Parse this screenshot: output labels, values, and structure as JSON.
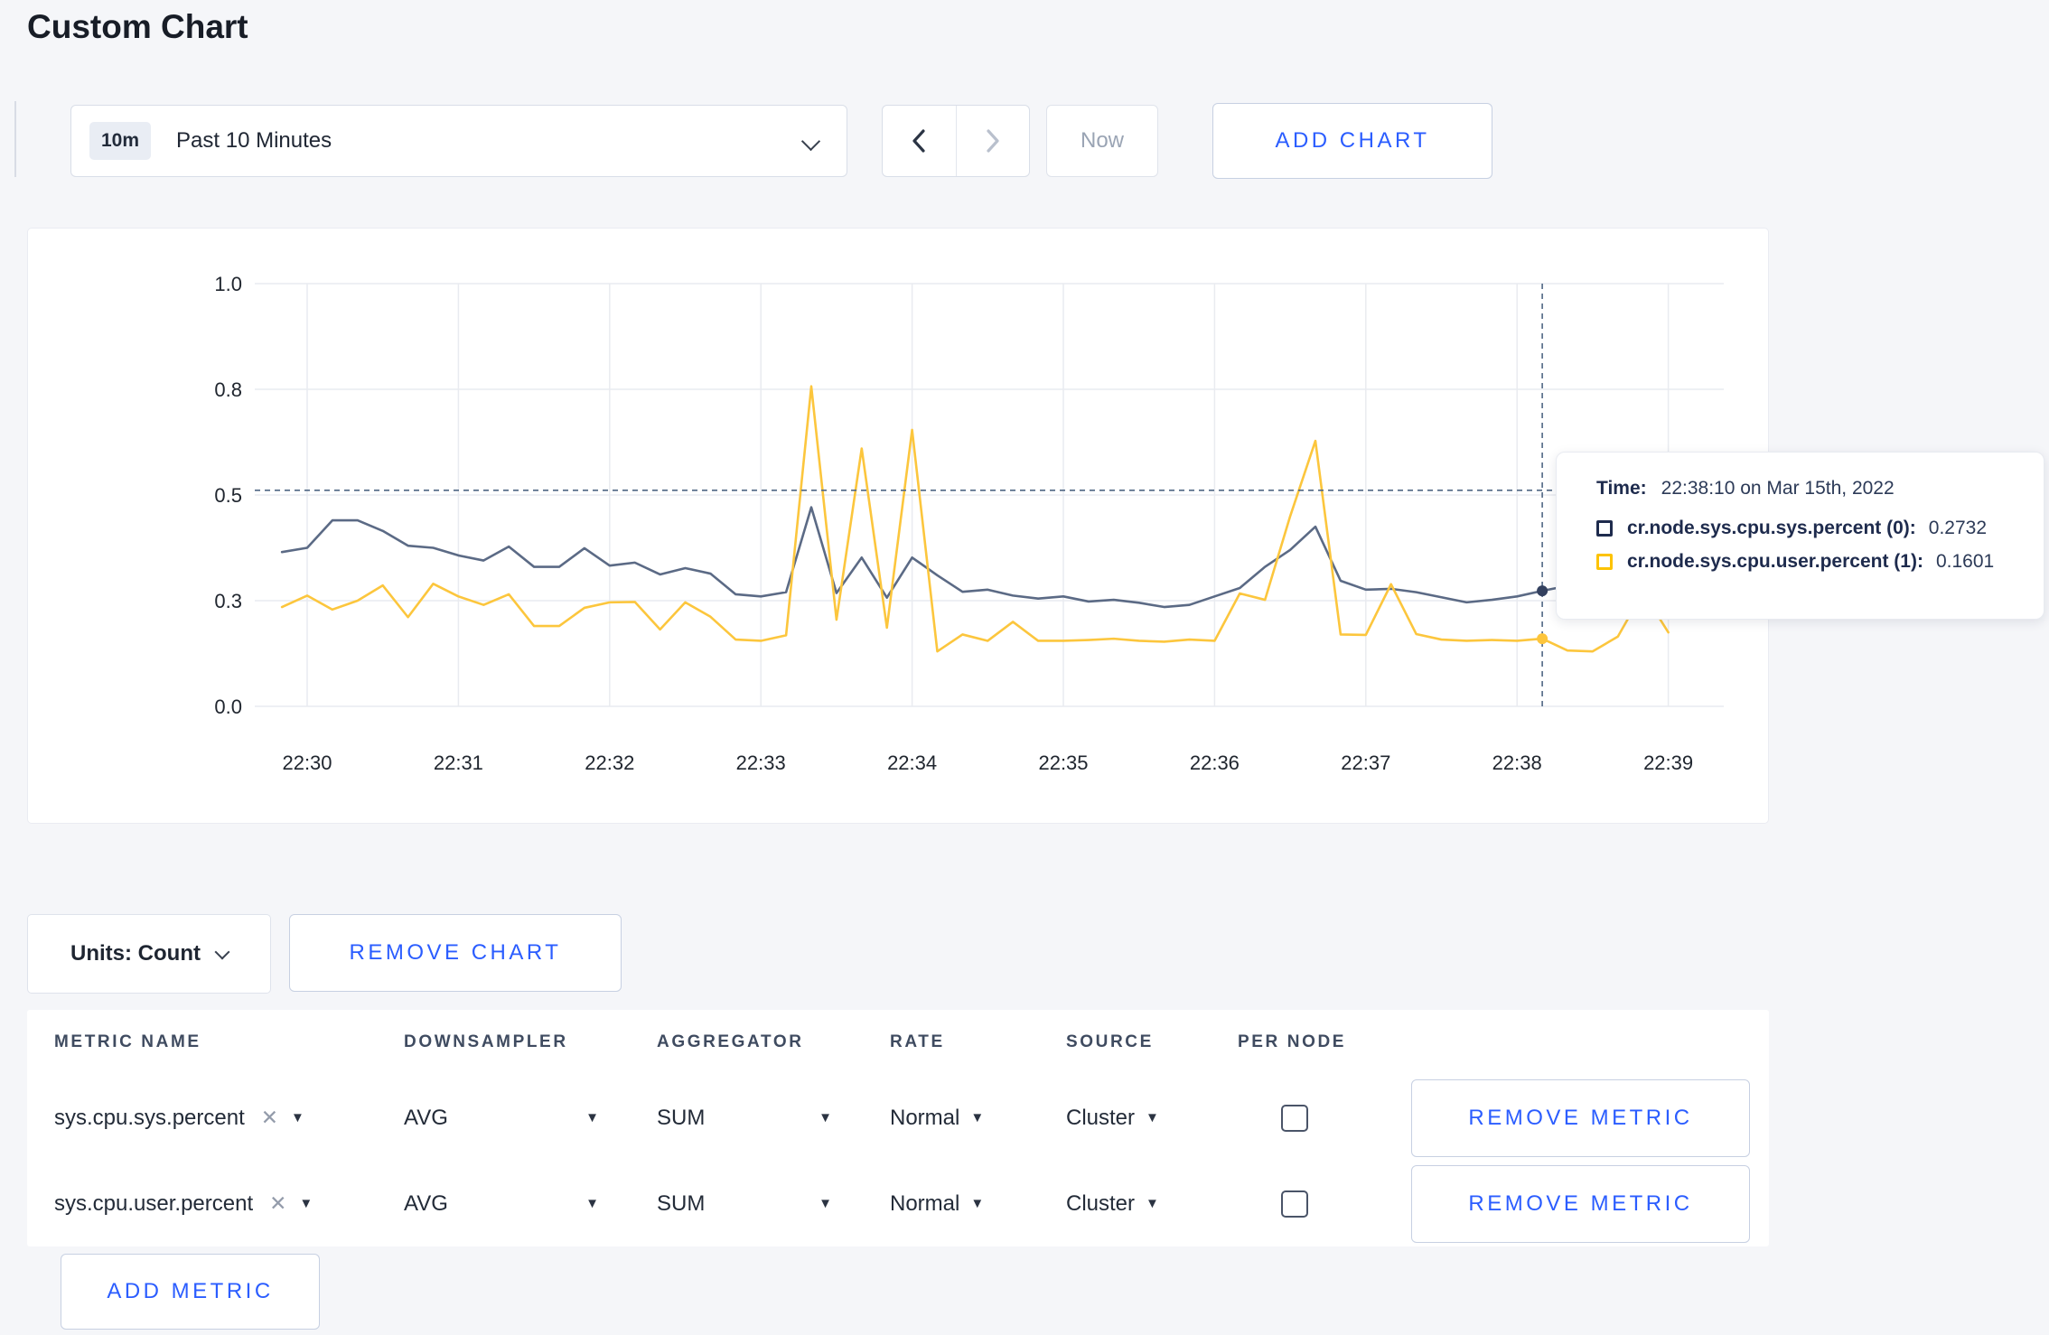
{
  "page": {
    "title": "Custom Chart",
    "background": "#f5f6f9",
    "accent": "#2b5dff"
  },
  "toolbar": {
    "time_range_badge": "10m",
    "time_range_label": "Past 10 Minutes",
    "now_label": "Now",
    "add_chart_label": "ADD CHART"
  },
  "chart_data": {
    "type": "line",
    "title": "",
    "xlabel": "",
    "ylabel": "",
    "ylim": [
      0,
      1
    ],
    "grid": true,
    "legend_position": "tooltip",
    "start_time": "22:29:50",
    "step_seconds": 10,
    "x_ticks": [
      "22:30",
      "22:31",
      "22:32",
      "22:33",
      "22:34",
      "22:35",
      "22:36",
      "22:37",
      "22:38",
      "22:39"
    ],
    "y_ticks": [
      {
        "value": 0,
        "label": "0.0"
      },
      {
        "value": 0.25,
        "label": "0.3"
      },
      {
        "value": 0.5,
        "label": "0.5"
      },
      {
        "value": 0.75,
        "label": "0.8"
      },
      {
        "value": 1,
        "label": "1.0"
      }
    ],
    "series": [
      {
        "name": "cr.node.sys.cpu.sys.percent",
        "color": "#5b6a85",
        "dot_color": "#34415f",
        "values": [
          0.365,
          0.375,
          0.44,
          0.44,
          0.415,
          0.38,
          0.375,
          0.357,
          0.345,
          0.378,
          0.33,
          0.33,
          0.374,
          0.333,
          0.34,
          0.312,
          0.327,
          0.314,
          0.265,
          0.26,
          0.27,
          0.471,
          0.268,
          0.352,
          0.257,
          0.352,
          0.31,
          0.271,
          0.276,
          0.262,
          0.255,
          0.26,
          0.248,
          0.252,
          0.245,
          0.235,
          0.24,
          0.26,
          0.28,
          0.33,
          0.37,
          0.425,
          0.297,
          0.276,
          0.278,
          0.27,
          0.258,
          0.246,
          0.252,
          0.26,
          0.2732,
          0.285
        ]
      },
      {
        "name": "cr.node.sys.cpu.user.percent",
        "color": "#fcc63d",
        "dot_color": "#fdc53c",
        "values": [
          0.235,
          0.262,
          0.229,
          0.25,
          0.286,
          0.211,
          0.29,
          0.26,
          0.24,
          0.265,
          0.19,
          0.19,
          0.233,
          0.246,
          0.247,
          0.182,
          0.246,
          0.212,
          0.158,
          0.155,
          0.168,
          0.757,
          0.205,
          0.61,
          0.186,
          0.654,
          0.13,
          0.17,
          0.155,
          0.2,
          0.155,
          0.155,
          0.157,
          0.16,
          0.155,
          0.153,
          0.158,
          0.155,
          0.267,
          0.252,
          0.45,
          0.628,
          0.17,
          0.169,
          0.289,
          0.171,
          0.158,
          0.155,
          0.157,
          0.155,
          0.1601,
          0.132,
          0.13,
          0.165,
          0.27,
          0.175
        ]
      }
    ],
    "crosshair": {
      "index": 50,
      "time": "22:38:10",
      "y_value": 0.511
    }
  },
  "tooltip": {
    "time_label": "Time:",
    "time_value": "22:38:10 on Mar 15th, 2022",
    "rows": [
      {
        "name": "cr.node.sys.cpu.sys.percent (0):",
        "value": "0.2732",
        "color": "#1e2b4d"
      },
      {
        "name": "cr.node.sys.cpu.user.percent (1):",
        "value": "0.1601",
        "color": "#fdc300"
      }
    ]
  },
  "chart_controls": {
    "units_label": "Units: Count",
    "remove_chart_label": "REMOVE CHART"
  },
  "metrics_table": {
    "headers": [
      "METRIC NAME",
      "DOWNSAMPLER",
      "AGGREGATOR",
      "RATE",
      "SOURCE",
      "PER NODE"
    ],
    "rows": [
      {
        "metric": "sys.cpu.sys.percent",
        "downsampler": "AVG",
        "aggregator": "SUM",
        "rate": "Normal",
        "source": "Cluster",
        "per_node": false,
        "remove_label": "REMOVE METRIC"
      },
      {
        "metric": "sys.cpu.user.percent",
        "downsampler": "AVG",
        "aggregator": "SUM",
        "rate": "Normal",
        "source": "Cluster",
        "per_node": false,
        "remove_label": "REMOVE METRIC"
      }
    ],
    "add_metric_label": "ADD METRIC"
  }
}
